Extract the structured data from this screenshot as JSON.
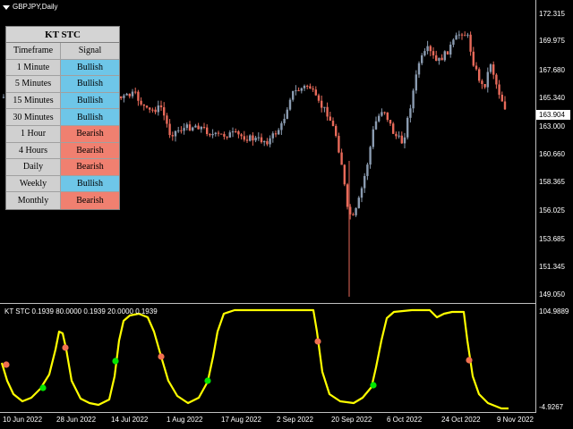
{
  "symbol": "GBPJPY,Daily",
  "price_axis": [
    "172.315",
    "169.975",
    "167.680",
    "165.340",
    "163.000",
    "160.660",
    "158.365",
    "156.025",
    "153.685",
    "151.345",
    "149.050"
  ],
  "current_price": "163.904",
  "dates": [
    "10 Jun 2022",
    "28 Jun 2022",
    "14 Jul 2022",
    "1 Aug 2022",
    "17 Aug 2022",
    "2 Sep 2022",
    "20 Sep 2022",
    "6 Oct 2022",
    "24 Oct 2022",
    "9 Nov 2022"
  ],
  "indicator": {
    "title": "KT STC 0.1939 80.0000 0.1939 20.0000 0.1939",
    "axis_top": "104.9889",
    "axis_bottom": "-4.9267"
  },
  "stc_table": {
    "title": "KT STC",
    "header_tf": "Timeframe",
    "header_sig": "Signal",
    "rows": [
      {
        "tf": "1 Minute",
        "sig": "Bullish"
      },
      {
        "tf": "5 Minutes",
        "sig": "Bullish"
      },
      {
        "tf": "15 Minutes",
        "sig": "Bullish"
      },
      {
        "tf": "30 Minutes",
        "sig": "Bullish"
      },
      {
        "tf": "1 Hour",
        "sig": "Bearish"
      },
      {
        "tf": "4 Hours",
        "sig": "Bearish"
      },
      {
        "tf": "Daily",
        "sig": "Bearish"
      },
      {
        "tf": "Weekly",
        "sig": "Bullish"
      },
      {
        "tf": "Monthly",
        "sig": "Bearish"
      }
    ]
  },
  "colors": {
    "bull_candle": "#8a9bb0",
    "bear_candle": "#e86a5a",
    "stc_line": "#ffff00",
    "buy_dot": "#00e600",
    "sell_dot": "#f07050",
    "bullish_cell": "#6ec6e8",
    "bearish_cell": "#f08070"
  }
}
